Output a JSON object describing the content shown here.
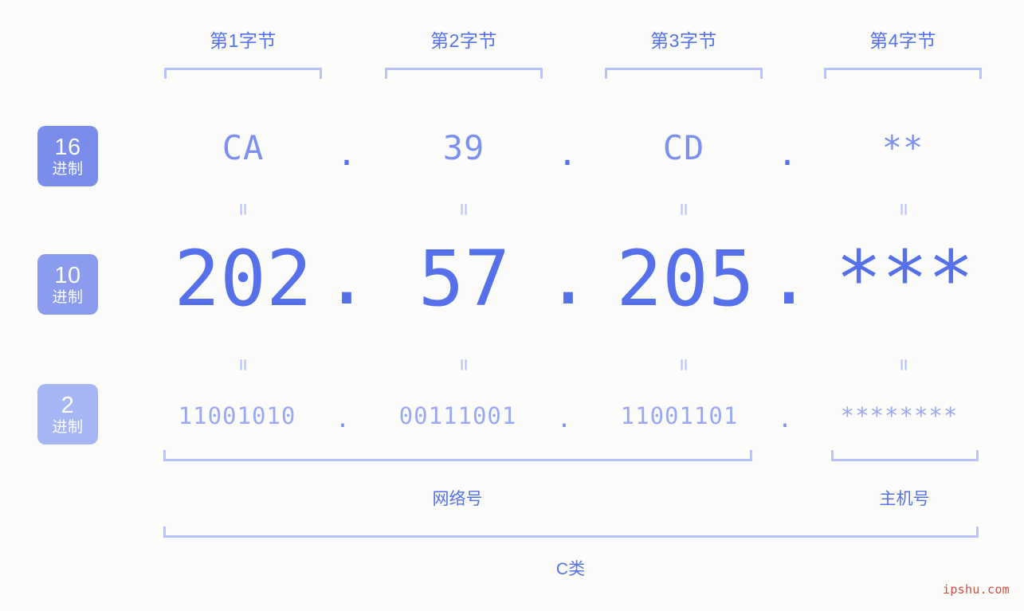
{
  "watermark": "ipshu.com",
  "byte_headers": [
    {
      "label": "第1字节"
    },
    {
      "label": "第2字节"
    },
    {
      "label": "第3字节"
    },
    {
      "label": "第4字节"
    }
  ],
  "radix_badges": [
    {
      "num": "16",
      "unit": "进制",
      "color": "#7a8ce9"
    },
    {
      "num": "10",
      "unit": "进制",
      "color": "#8b9bee"
    },
    {
      "num": "2",
      "unit": "进制",
      "color": "#a6b5f4"
    }
  ],
  "rows": {
    "hex": {
      "values": [
        "CA",
        "39",
        "CD",
        "**"
      ],
      "separator": "."
    },
    "decimal": {
      "values": [
        "202",
        "57",
        "205",
        "***"
      ],
      "separator": "."
    },
    "binary": {
      "values": [
        "11001010",
        "00111001",
        "11001101",
        "********"
      ],
      "separator": "."
    }
  },
  "equals_symbol": "=",
  "sections": {
    "network_label": "网络号",
    "host_label": "主机号",
    "class_label": "C类"
  },
  "ip_address": "202.57.205.***"
}
